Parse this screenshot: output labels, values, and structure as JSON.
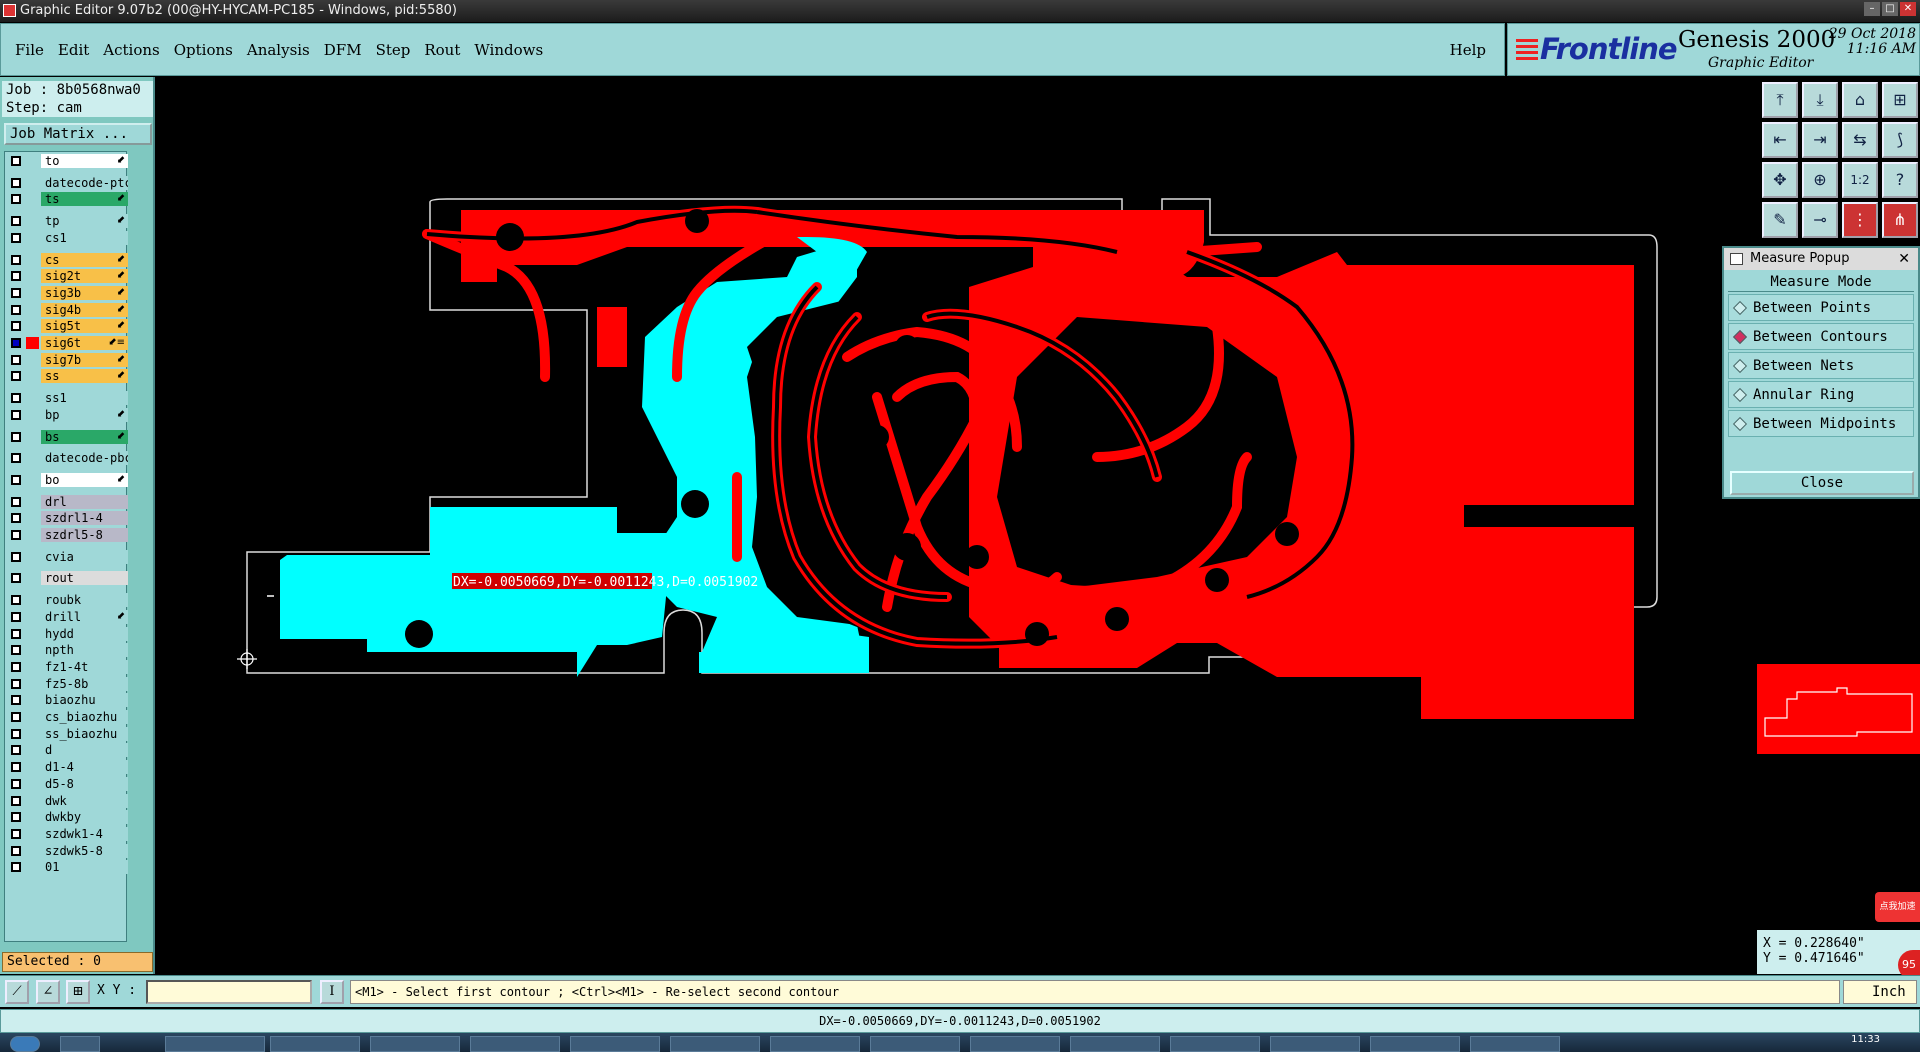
{
  "window": {
    "title": "Graphic Editor 9.07b2 (00@HY-HYCAM-PC185 - Windows, pid:5580)"
  },
  "menu": {
    "items": [
      "File",
      "Edit",
      "Actions",
      "Options",
      "Analysis",
      "DFM",
      "Step",
      "Rout",
      "Windows"
    ],
    "help": "Help"
  },
  "brand": {
    "logo": "Frontline",
    "product": "Genesis 2000",
    "subtitle": "Graphic Editor",
    "date": "29 Oct 2018",
    "time": "11:16 AM"
  },
  "job": {
    "job_line": "Job : 8b0568nwa0",
    "step_line": "Step: cam",
    "matrix_button": "Job Matrix ..."
  },
  "layers": [
    {
      "name": "to",
      "color": "#ffffff",
      "flag": "⬋"
    },
    {
      "name": "datecode-ptc",
      "color": "#9fd8d8",
      "flag": ""
    },
    {
      "name": "ts",
      "color": "#2aa868",
      "flag": "⬋"
    },
    {
      "name": "tp",
      "color": "#9fd8d8",
      "flag": "⬋"
    },
    {
      "name": "cs1",
      "color": "#9fd8d8",
      "flag": ""
    },
    {
      "name": "cs",
      "color": "#f8c048",
      "flag": "⬋"
    },
    {
      "name": "sig2t",
      "color": "#f8c048",
      "flag": "⬋"
    },
    {
      "name": "sig3b",
      "color": "#f8c048",
      "flag": "⬋"
    },
    {
      "name": "sig4b",
      "color": "#f8c048",
      "flag": "⬋"
    },
    {
      "name": "sig5t",
      "color": "#f8c048",
      "flag": "⬋"
    },
    {
      "name": "sig6t",
      "color": "#f8c048",
      "flag": "⬋≡"
    },
    {
      "name": "sig7b",
      "color": "#f8c048",
      "flag": "⬋"
    },
    {
      "name": "ss",
      "color": "#f8c048",
      "flag": "⬋"
    },
    {
      "name": "ss1",
      "color": "#9fd8d8",
      "flag": ""
    },
    {
      "name": "bp",
      "color": "#9fd8d8",
      "flag": "⬋"
    },
    {
      "name": "bs",
      "color": "#2aa868",
      "flag": "⬋"
    },
    {
      "name": "datecode-pbc",
      "color": "#9fd8d8",
      "flag": ""
    },
    {
      "name": "bo",
      "color": "#ffffff",
      "flag": "⬋"
    },
    {
      "name": "drl",
      "color": "#b8b8c8",
      "flag": ""
    },
    {
      "name": "szdrl1-4",
      "color": "#b8b8c8",
      "flag": ""
    },
    {
      "name": "szdrl5-8",
      "color": "#b8b8c8",
      "flag": ""
    },
    {
      "name": "cvia",
      "color": "#9fd8d8",
      "flag": ""
    },
    {
      "name": "rout",
      "color": "#dcdcdc",
      "flag": ""
    },
    {
      "name": "roubk",
      "color": "#9fd8d8",
      "flag": ""
    },
    {
      "name": "drill",
      "color": "#9fd8d8",
      "flag": "⬋"
    },
    {
      "name": "hydd",
      "color": "#9fd8d8",
      "flag": ""
    },
    {
      "name": "npth",
      "color": "#9fd8d8",
      "flag": ""
    },
    {
      "name": "fz1-4t",
      "color": "#9fd8d8",
      "flag": ""
    },
    {
      "name": "fz5-8b",
      "color": "#9fd8d8",
      "flag": ""
    },
    {
      "name": "biaozhu",
      "color": "#9fd8d8",
      "flag": ""
    },
    {
      "name": "cs_biaozhu",
      "color": "#9fd8d8",
      "flag": ""
    },
    {
      "name": "ss_biaozhu",
      "color": "#9fd8d8",
      "flag": ""
    },
    {
      "name": "d",
      "color": "#9fd8d8",
      "flag": ""
    },
    {
      "name": "d1-4",
      "color": "#9fd8d8",
      "flag": ""
    },
    {
      "name": "d5-8",
      "color": "#9fd8d8",
      "flag": ""
    },
    {
      "name": "dwk",
      "color": "#9fd8d8",
      "flag": ""
    },
    {
      "name": "dwkby",
      "color": "#9fd8d8",
      "flag": ""
    },
    {
      "name": "szdwk1-4",
      "color": "#9fd8d8",
      "flag": ""
    },
    {
      "name": "szdwk5-8",
      "color": "#9fd8d8",
      "flag": ""
    },
    {
      "name": "01",
      "color": "#9fd8d8",
      "flag": ""
    }
  ],
  "selected": "Selected : 0",
  "measure_popup": {
    "title": "Measure Popup",
    "mode_label": "Measure Mode",
    "options": [
      {
        "label": "Between Points",
        "selected": false
      },
      {
        "label": "Between Contours",
        "selected": true
      },
      {
        "label": "Between Nets",
        "selected": false
      },
      {
        "label": "Annular Ring",
        "selected": false
      },
      {
        "label": "Between Midpoints",
        "selected": false
      }
    ],
    "close_label": "Close"
  },
  "measurement": {
    "text": "DX=-0.0050669,DY=-0.0011243,D=0.0051902"
  },
  "coords": {
    "x": "X = 0.228640\"",
    "y": "Y = 0.471646\""
  },
  "command": {
    "xy_label": "X Y :",
    "xy_value": "",
    "prompt": "<M1> - Select first contour ; <Ctrl><M1> - Re-select second contour",
    "unit": "Inch"
  },
  "status": {
    "text": "DX=-0.0050669,DY=-0.0011243,D=0.0051902"
  },
  "badges": {
    "ad": "点我加速",
    "count": "95"
  },
  "taskbar": {
    "clock": "11:33"
  },
  "colors": {
    "menu_bg": "#9fd8d8",
    "copper_red": "#ff0000",
    "copper_cyan": "#00ffff",
    "highlight": "#f8c048"
  }
}
